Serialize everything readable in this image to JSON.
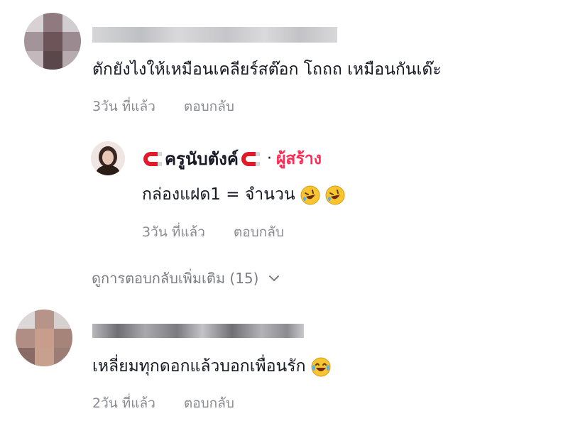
{
  "comments": [
    {
      "text": "ตักยังไงให้เหมือนเคลียร์สต๊อก โถถถ เหมือนกันเด๊ะ",
      "time": "3วัน ที่แล้ว",
      "reply_label": "ตอบกลับ"
    },
    {
      "text": "เหลี่ยมทุกดอกแล้วบอกเพื่อนรัก",
      "time": "2วัน ที่แล้ว",
      "reply_label": "ตอบกลับ"
    }
  ],
  "reply": {
    "author": "ครูนับตังค์",
    "separator": "·",
    "creator_badge": "ผู้สร้าง",
    "text": "กล่องแฝด1 = จำนวน",
    "time": "3วัน ที่แล้ว",
    "reply_label": "ตอบกลับ"
  },
  "view_more": {
    "label": "ดูการตอบกลับเพิ่มเติม (15)"
  },
  "colors": {
    "creator": "#fe2c55",
    "meta": "#8a8b91",
    "text": "#161823"
  },
  "icons": {
    "emoji_1": "rolling-laughing-emoji",
    "emoji_2": "tears-of-joy-emoji",
    "badge": "magnet-emoji",
    "expand": "chevron-down-icon"
  }
}
